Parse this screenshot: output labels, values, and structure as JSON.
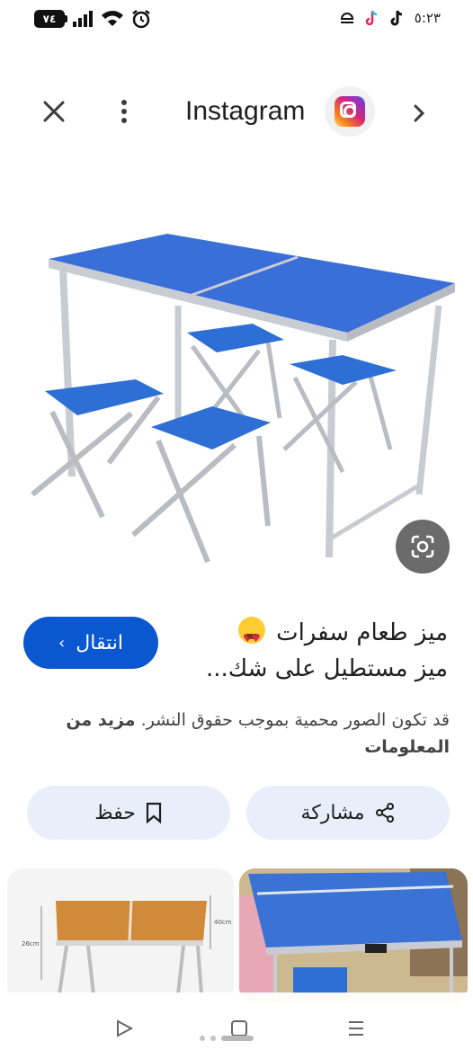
{
  "status_bar": {
    "battery": "٧٤",
    "time": "٥:٢٣"
  },
  "header": {
    "title": "Instagram"
  },
  "result": {
    "visit_label": "انتقال",
    "title_line1": "ميز طعام سفرات",
    "title_line2": "ميز مستطيل على شك...",
    "copyright_text": "قد تكون الصور محمية بموجب حقوق النشر.",
    "copyright_more": "مزيد من المعلومات"
  },
  "actions": {
    "share_label": "مشاركة",
    "save_label": "حفظ"
  },
  "thumbs": {
    "left_dim_height": "26cm",
    "left_dim_depth": "40cm"
  },
  "colors": {
    "accent": "#0b57d0",
    "chip_bg": "#e8effa",
    "table_blue": "#3a6fd8"
  }
}
